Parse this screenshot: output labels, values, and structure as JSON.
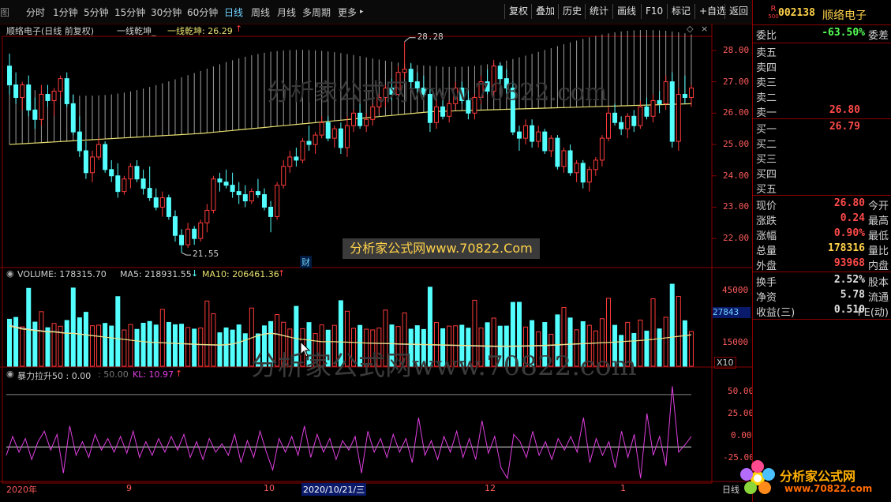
{
  "toolbar": {
    "left_cut": "图",
    "periods": [
      "分时",
      "1分钟",
      "5分钟",
      "15分钟",
      "30分钟",
      "60分钟",
      "日线",
      "周线",
      "月线",
      "多周期",
      "更多"
    ],
    "active_period": "日线",
    "more_caret": "▸",
    "buttons": [
      "复权",
      "叠加",
      "历史",
      "统计",
      "画线",
      "F10",
      "标记",
      "+自选",
      "返回"
    ]
  },
  "main_header": {
    "stock_label": "顺络电子(日线 前复权)",
    "indicator1": "一线乾坤_",
    "indicator2": "一线乾坤: 26.29",
    "up_arrow": "↑",
    "diamond": "◇",
    "close_x": "×"
  },
  "price_axis": {
    "ticks": [
      "28.00",
      "27.00",
      "26.00",
      "25.00",
      "24.00",
      "23.00",
      "22.00"
    ],
    "high_label": "28.28",
    "low_label": "21.55",
    "fin_marker": "财"
  },
  "volume_header": {
    "label": "VOLUME: 178315.70",
    "ma5": "MA5: 218931.55",
    "ma5_arrow": "↓",
    "ma10": "MA10: 206461.36",
    "ma10_arrow": "↑"
  },
  "volume_axis": {
    "ticks": [
      "45000",
      "15000"
    ],
    "box_value": "27843",
    "multiplier": "X10"
  },
  "indicator_header": {
    "label": "暴力拉升50 : 0.00",
    "val": ": 50.00",
    "kl": "KL: 10.97",
    "kl_arrow": "↑"
  },
  "indicator_axis": {
    "ticks": [
      "50.00",
      "25.00",
      "0.00",
      "-25.00"
    ]
  },
  "date_axis": {
    "labels": [
      "2020年",
      "9",
      "10",
      "2020/10/21/三",
      "12",
      "1"
    ],
    "corner": "日线"
  },
  "watermarks": {
    "price": "分析家公式网www.70822.com",
    "volume": "分析家公式网www.70822.com",
    "banner": "分析家公式网www.70822.Com"
  },
  "panel": {
    "badge_top": "R",
    "badge_bottom": "500",
    "code": "002138",
    "name": "顺络电子",
    "weibi_label": "委比",
    "weibi_value": "-63.50%",
    "weicha_label": "委差",
    "sell": [
      {
        "label": "卖五",
        "price": ""
      },
      {
        "label": "卖四",
        "price": ""
      },
      {
        "label": "卖三",
        "price": ""
      },
      {
        "label": "卖二",
        "price": ""
      },
      {
        "label": "卖一",
        "price": "26.80"
      }
    ],
    "buy": [
      {
        "label": "买一",
        "price": "26.79"
      },
      {
        "label": "买二",
        "price": ""
      },
      {
        "label": "买三",
        "price": ""
      },
      {
        "label": "买四",
        "price": ""
      },
      {
        "label": "买五",
        "price": ""
      }
    ],
    "quote": [
      {
        "l1": "现价",
        "v1": "26.80",
        "l2": "今开",
        "c": "#ff4a4a"
      },
      {
        "l1": "涨跌",
        "v1": "0.24",
        "l2": "最高",
        "c": "#ff4a4a"
      },
      {
        "l1": "涨幅",
        "v1": "0.90%",
        "l2": "最低",
        "c": "#ff4a4a"
      },
      {
        "l1": "总量",
        "v1": "178316",
        "l2": "量比",
        "c": "#ffd24a"
      },
      {
        "l1": "外盘",
        "v1": "93968",
        "l2": "内盘",
        "c": "#ff4a4a"
      }
    ],
    "stats": [
      {
        "l1": "换手",
        "v1": "2.52%",
        "l2": "股本"
      },
      {
        "l1": "净资",
        "v1": "5.78",
        "l2": "流通"
      },
      {
        "l1": "收益(三)",
        "v1": "0.510",
        "l2": "PE(动)"
      }
    ],
    "logo_text": "分析家公式网",
    "logo_url": "www.70822.com"
  },
  "colors": {
    "up": "#ff3b3b",
    "down": "#54ffff",
    "yline": "#e8e070",
    "magenta": "#e040e0"
  },
  "chart_data": {
    "type": "candlestick",
    "price_ylim": [
      21.3,
      28.4
    ],
    "candles": [
      [
        27.5,
        27.9,
        26.6,
        26.9
      ],
      [
        26.9,
        27.3,
        26.3,
        26.5
      ],
      [
        26.5,
        27.0,
        26.1,
        26.9
      ],
      [
        26.9,
        27.2,
        25.9,
        26.1
      ],
      [
        26.1,
        26.5,
        25.5,
        25.8
      ],
      [
        25.8,
        26.9,
        25.6,
        26.6
      ],
      [
        26.6,
        26.9,
        26.2,
        26.4
      ],
      [
        26.4,
        26.8,
        25.9,
        26.7
      ],
      [
        26.7,
        27.2,
        26.5,
        27.1
      ],
      [
        27.1,
        27.3,
        26.2,
        26.3
      ],
      [
        26.3,
        26.6,
        25.3,
        25.4
      ],
      [
        25.4,
        25.9,
        24.6,
        24.8
      ],
      [
        24.8,
        25.1,
        23.9,
        24.1
      ],
      [
        24.1,
        24.8,
        23.8,
        24.6
      ],
      [
        24.6,
        25.2,
        24.5,
        25.0
      ],
      [
        25.0,
        25.1,
        24.1,
        24.2
      ],
      [
        24.2,
        24.5,
        23.8,
        24.0
      ],
      [
        24.0,
        24.4,
        23.3,
        23.5
      ],
      [
        23.5,
        24.0,
        23.4,
        23.9
      ],
      [
        23.9,
        24.4,
        23.6,
        24.3
      ],
      [
        24.3,
        24.5,
        23.8,
        23.9
      ],
      [
        23.9,
        24.2,
        23.4,
        23.6
      ],
      [
        23.6,
        24.3,
        23.2,
        23.3
      ],
      [
        23.3,
        23.6,
        22.9,
        23.0
      ],
      [
        23.0,
        23.5,
        22.7,
        23.3
      ],
      [
        23.3,
        23.4,
        22.6,
        22.7
      ],
      [
        22.7,
        22.9,
        21.9,
        22.1
      ],
      [
        22.1,
        22.3,
        21.55,
        21.8
      ],
      [
        21.8,
        22.5,
        21.7,
        22.3
      ],
      [
        22.3,
        22.4,
        21.8,
        22.0
      ],
      [
        22.0,
        22.6,
        21.9,
        22.5
      ],
      [
        22.5,
        23.1,
        22.2,
        22.9
      ],
      [
        22.9,
        24.0,
        22.8,
        23.9
      ],
      [
        23.9,
        24.1,
        23.5,
        23.8
      ],
      [
        23.8,
        24.2,
        23.6,
        23.7
      ],
      [
        23.7,
        24.1,
        23.3,
        23.5
      ],
      [
        23.5,
        23.8,
        23.1,
        23.4
      ],
      [
        23.4,
        23.7,
        23.0,
        23.2
      ],
      [
        23.2,
        23.6,
        23.1,
        23.5
      ],
      [
        23.5,
        23.9,
        23.3,
        23.4
      ],
      [
        23.4,
        23.6,
        22.9,
        23.0
      ],
      [
        23.0,
        23.2,
        22.2,
        22.7
      ],
      [
        22.7,
        23.8,
        22.6,
        23.7
      ],
      [
        23.7,
        24.5,
        23.6,
        24.3
      ],
      [
        24.3,
        24.8,
        24.1,
        24.6
      ],
      [
        24.6,
        24.9,
        24.3,
        24.5
      ],
      [
        24.5,
        25.2,
        24.4,
        25.1
      ],
      [
        25.1,
        25.6,
        24.8,
        25.0
      ],
      [
        25.0,
        25.4,
        24.7,
        25.3
      ],
      [
        25.3,
        25.9,
        25.2,
        25.7
      ],
      [
        25.7,
        25.9,
        25.1,
        25.2
      ],
      [
        25.2,
        25.6,
        24.9,
        25.5
      ],
      [
        25.5,
        25.7,
        24.7,
        24.9
      ],
      [
        24.9,
        25.9,
        24.6,
        25.6
      ],
      [
        25.6,
        26.1,
        25.4,
        26.0
      ],
      [
        26.0,
        26.3,
        25.5,
        25.6
      ],
      [
        25.6,
        26.0,
        25.4,
        25.8
      ],
      [
        25.8,
        26.3,
        25.6,
        26.2
      ],
      [
        26.2,
        26.6,
        26.0,
        26.5
      ],
      [
        26.5,
        26.9,
        26.2,
        26.8
      ],
      [
        26.8,
        27.1,
        26.4,
        26.6
      ],
      [
        26.6,
        27.5,
        26.5,
        27.3
      ],
      [
        27.3,
        28.28,
        27.1,
        27.4
      ],
      [
        27.4,
        27.6,
        26.8,
        27.0
      ],
      [
        27.0,
        27.3,
        26.6,
        26.8
      ],
      [
        26.8,
        27.2,
        26.5,
        26.6
      ],
      [
        26.6,
        26.8,
        25.4,
        25.7
      ],
      [
        25.7,
        26.4,
        25.5,
        26.2
      ],
      [
        26.2,
        26.5,
        25.8,
        25.9
      ],
      [
        25.9,
        26.4,
        25.7,
        26.3
      ],
      [
        26.3,
        27.0,
        26.1,
        26.8
      ],
      [
        26.8,
        27.0,
        26.3,
        26.4
      ],
      [
        26.4,
        26.7,
        25.8,
        26.0
      ],
      [
        26.0,
        26.6,
        25.8,
        26.5
      ],
      [
        26.5,
        27.2,
        26.3,
        27.0
      ],
      [
        27.0,
        27.4,
        26.6,
        26.7
      ],
      [
        26.7,
        27.7,
        26.5,
        27.5
      ],
      [
        27.5,
        27.6,
        26.9,
        27.1
      ],
      [
        27.1,
        27.4,
        26.6,
        26.8
      ],
      [
        26.8,
        27.0,
        25.3,
        25.4
      ],
      [
        25.4,
        25.6,
        24.8,
        25.2
      ],
      [
        25.2,
        25.8,
        25.0,
        25.6
      ],
      [
        25.6,
        25.8,
        24.9,
        25.1
      ],
      [
        25.1,
        25.6,
        24.9,
        25.4
      ],
      [
        25.4,
        25.5,
        24.7,
        24.8
      ],
      [
        24.8,
        25.3,
        24.6,
        25.2
      ],
      [
        25.2,
        25.3,
        24.2,
        24.3
      ],
      [
        24.3,
        24.9,
        24.1,
        24.8
      ],
      [
        24.8,
        25.0,
        24.0,
        24.1
      ],
      [
        24.1,
        24.5,
        23.8,
        24.4
      ],
      [
        24.4,
        24.5,
        23.6,
        23.8
      ],
      [
        23.8,
        24.3,
        23.5,
        24.2
      ],
      [
        24.2,
        24.6,
        24.0,
        24.5
      ],
      [
        24.5,
        25.3,
        24.3,
        25.2
      ],
      [
        25.2,
        26.2,
        25.1,
        26.0
      ],
      [
        26.0,
        26.3,
        25.6,
        25.7
      ],
      [
        25.7,
        25.9,
        25.3,
        25.5
      ],
      [
        25.5,
        26.0,
        25.2,
        25.9
      ],
      [
        25.9,
        26.1,
        25.4,
        25.6
      ],
      [
        25.6,
        26.4,
        25.5,
        26.2
      ],
      [
        26.2,
        26.5,
        25.8,
        25.9
      ],
      [
        25.9,
        26.6,
        25.7,
        26.4
      ],
      [
        26.4,
        26.7,
        26.0,
        26.3
      ],
      [
        26.3,
        27.2,
        26.1,
        27.0
      ],
      [
        27.0,
        27.3,
        24.9,
        25.1
      ],
      [
        25.1,
        26.8,
        24.8,
        26.6
      ],
      [
        26.6,
        27.2,
        26.3,
        26.5
      ],
      [
        26.5,
        26.9,
        26.2,
        26.8
      ]
    ],
    "volume_ylim": [
      0,
      54000
    ],
    "volume_ma_line": [
      26000,
      25000,
      24000,
      23500,
      23000,
      22500,
      22000,
      22000,
      21500,
      21000,
      21000,
      20500,
      20000,
      19500,
      19000,
      18500,
      18000,
      17500,
      17000,
      16500,
      16000,
      15500,
      15200,
      15000,
      14800,
      14600,
      14400,
      14200,
      14000,
      13800,
      13600,
      13500,
      13400,
      13300,
      13500,
      14000,
      15000,
      16500,
      18000,
      19500,
      20500,
      21000,
      20500,
      19500,
      18500,
      17500,
      17000,
      16500,
      16000,
      15500,
      15500,
      15500,
      15300,
      15200,
      15000,
      14800,
      14600,
      14500,
      14400,
      14300,
      14200,
      14000,
      13900,
      13800,
      13700,
      13600,
      13500,
      13400,
      13300,
      13200,
      13100,
      13000,
      12900,
      12800,
      12700,
      12600,
      12500,
      12500,
      12500,
      12500,
      12600,
      12700,
      12800,
      12900,
      13000,
      13200,
      13400,
      13600,
      13800,
      14000,
      14200,
      14400,
      14600,
      14800,
      15000,
      15200,
      15500,
      15800,
      16000,
      16300,
      16600,
      17000,
      17500,
      18000,
      18500,
      19000,
      19500,
      20000
    ],
    "indicator_ylim": [
      -30,
      65
    ],
    "indicator_ref_lines": [
      50,
      0
    ],
    "indicator_values": [
      -8,
      10,
      -5,
      8,
      -12,
      5,
      15,
      -3,
      12,
      -25,
      20,
      -8,
      5,
      -10,
      12,
      -3,
      8,
      -5,
      10,
      -6,
      15,
      -10,
      5,
      -8,
      8,
      -5,
      10,
      -3,
      12,
      -10,
      5,
      -12,
      8,
      -5,
      3,
      -8,
      12,
      -15,
      6,
      -10,
      15,
      -5,
      -22,
      8,
      -5,
      10,
      -8,
      20,
      -10,
      12,
      -5,
      8,
      -12,
      6,
      -3,
      10,
      -25,
      15,
      -5,
      8,
      -10,
      12,
      -5,
      8,
      -15,
      28,
      -8,
      6,
      -12,
      10,
      -5,
      15,
      -10,
      8,
      -12,
      25,
      -6,
      10,
      -20,
      -30,
      12,
      5,
      -10,
      15,
      -8,
      5,
      -12,
      8,
      -3,
      10,
      -5,
      28,
      -15,
      8,
      -8,
      5,
      -20,
      15,
      -10,
      12,
      -30,
      32,
      -8,
      10,
      -18,
      58,
      -5,
      2,
      10
    ]
  }
}
